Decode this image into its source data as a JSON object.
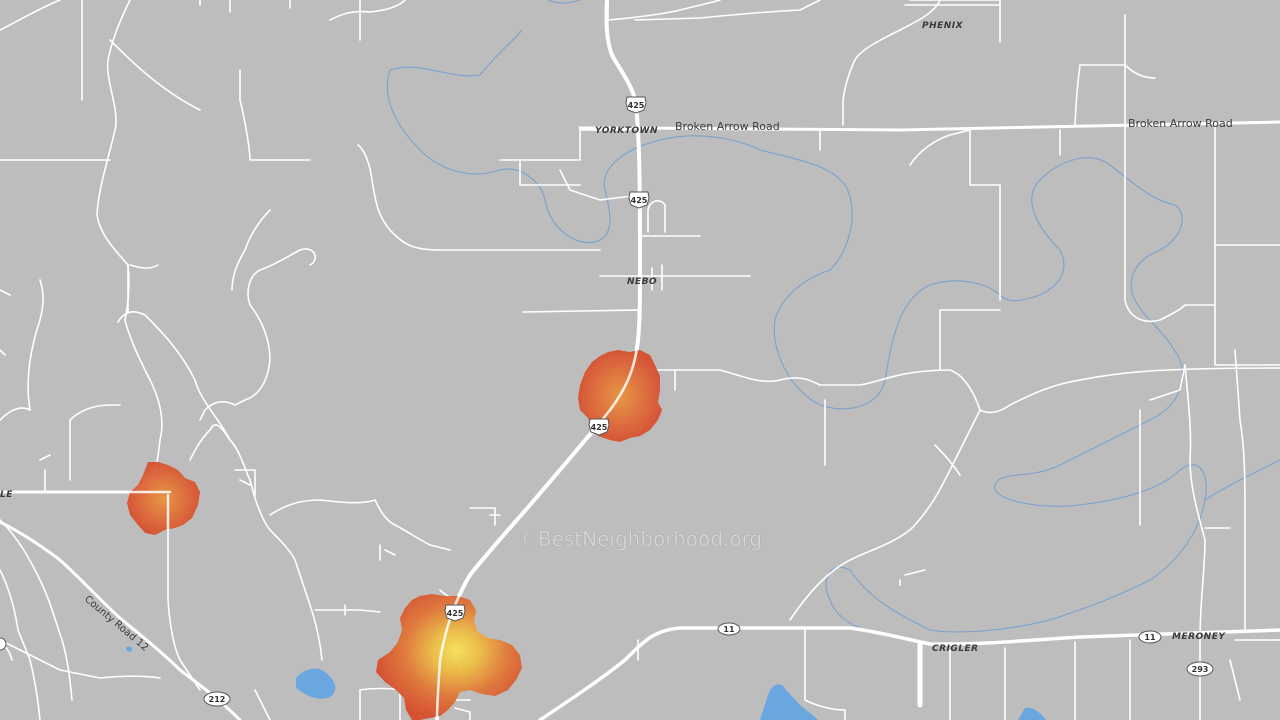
{
  "map": {
    "watermark": "©BestNeighborhood.org",
    "colors": {
      "land": "#bdbdbd",
      "road": "#ffffff",
      "stream": "#6f9ed0",
      "water": "#6aa6e0",
      "heat_low": "#d9512f",
      "heat_mid": "#e8853a",
      "heat_high": "#f5d94a"
    },
    "places": {
      "phenix": "PHENIX",
      "yorktown": "YORKTOWN",
      "nebo": "NEBO",
      "crigler": "CRIGLER",
      "meroney": "MERONEY",
      "left_edge": "LE"
    },
    "roads": {
      "broken_arrow_1": "Broken Arrow Road",
      "broken_arrow_2": "Broken Arrow Road",
      "county_road_12": "County Road 12"
    },
    "shields": {
      "us425_a": "425",
      "us425_b": "425",
      "us425_c": "425",
      "us425_d": "425",
      "hwy11_a": "11",
      "hwy11_b": "11",
      "hwy212": "212",
      "hwy293": "293"
    }
  }
}
